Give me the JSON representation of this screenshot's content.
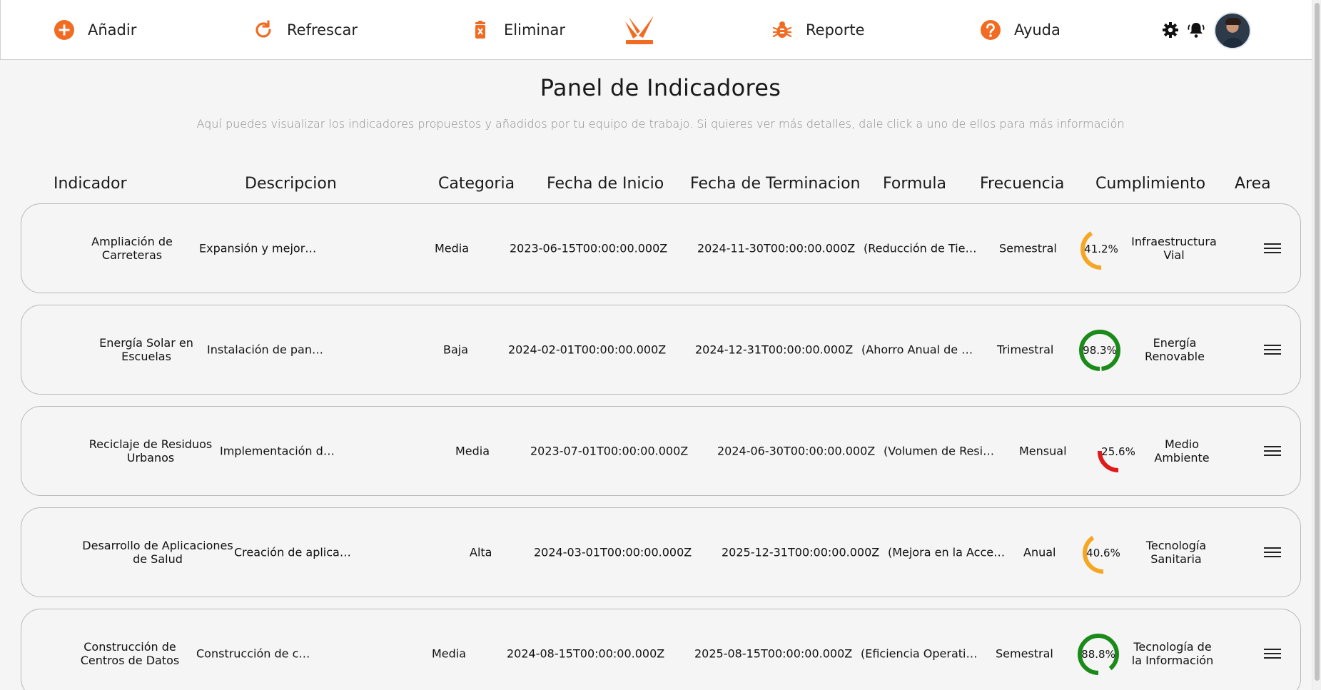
{
  "toolbar": {
    "add_label": "Añadir",
    "refresh_label": "Refrescar",
    "delete_label": "Eliminar",
    "report_label": "Reporte",
    "help_label": "Ayuda"
  },
  "colors": {
    "accent": "#f26b22",
    "gauge_green": "#1a8a1a",
    "gauge_orange": "#f5a623",
    "gauge_red": "#e0191b",
    "track": "#dddddd"
  },
  "page": {
    "title": "Panel de Indicadores",
    "subtitle": "Aquí puedes visualizar los indicadores propuestos y añadidos por tu equipo de trabajo. Si quieres ver más detalles, dale click a uno de ellos para más información"
  },
  "columns": [
    "Indicador",
    "Descripcion",
    "Categoria",
    "Fecha de Inicio",
    "Fecha de Terminacion",
    "Formula",
    "Frecuencia",
    "Cumplimiento",
    "Area"
  ],
  "rows": [
    {
      "indicador": "Ampliación de Carreteras",
      "descripcion": "Expansión y mejor…",
      "categoria": "Media",
      "inicio": "2023-06-15T00:00:00.000Z",
      "fin": "2024-11-30T00:00:00.000Z",
      "formula": "(Reducción de Tie…",
      "frecuencia": "Semestral",
      "cumplimiento": 41.2,
      "cumplimiento_label": "41.2%",
      "gauge_color": "orange",
      "area": "Infraestructura Vial"
    },
    {
      "indicador": "Energía Solar en Escuelas",
      "descripcion": "Instalación de pan…",
      "categoria": "Baja",
      "inicio": "2024-02-01T00:00:00.000Z",
      "fin": "2024-12-31T00:00:00.000Z",
      "formula": "(Ahorro Anual de …",
      "frecuencia": "Trimestral",
      "cumplimiento": 98.3,
      "cumplimiento_label": "98.3%",
      "gauge_color": "green",
      "area": "Energía Renovable"
    },
    {
      "indicador": "Reciclaje de Residuos Urbanos",
      "descripcion": "Implementación d…",
      "categoria": "Media",
      "inicio": "2023-07-01T00:00:00.000Z",
      "fin": "2024-06-30T00:00:00.000Z",
      "formula": "(Volumen de Resi…",
      "frecuencia": "Mensual",
      "cumplimiento": 25.6,
      "cumplimiento_label": "25.6%",
      "gauge_color": "red",
      "area": "Medio Ambiente"
    },
    {
      "indicador": "Desarrollo de Aplicaciones de Salud",
      "descripcion": "Creación de aplica…",
      "categoria": "Alta",
      "inicio": "2024-03-01T00:00:00.000Z",
      "fin": "2025-12-31T00:00:00.000Z",
      "formula": "(Mejora en la Acce…",
      "frecuencia": "Anual",
      "cumplimiento": 40.6,
      "cumplimiento_label": "40.6%",
      "gauge_color": "orange",
      "area": "Tecnología Sanitaria"
    },
    {
      "indicador": "Construcción de Centros de Datos",
      "descripcion": "Construcción de c…",
      "categoria": "Media",
      "inicio": "2024-08-15T00:00:00.000Z",
      "fin": "2025-08-15T00:00:00.000Z",
      "formula": "(Eficiencia Operati…",
      "frecuencia": "Semestral",
      "cumplimiento": 88.8,
      "cumplimiento_label": "88.8%",
      "gauge_color": "green",
      "area": "Tecnología de la Información"
    }
  ]
}
